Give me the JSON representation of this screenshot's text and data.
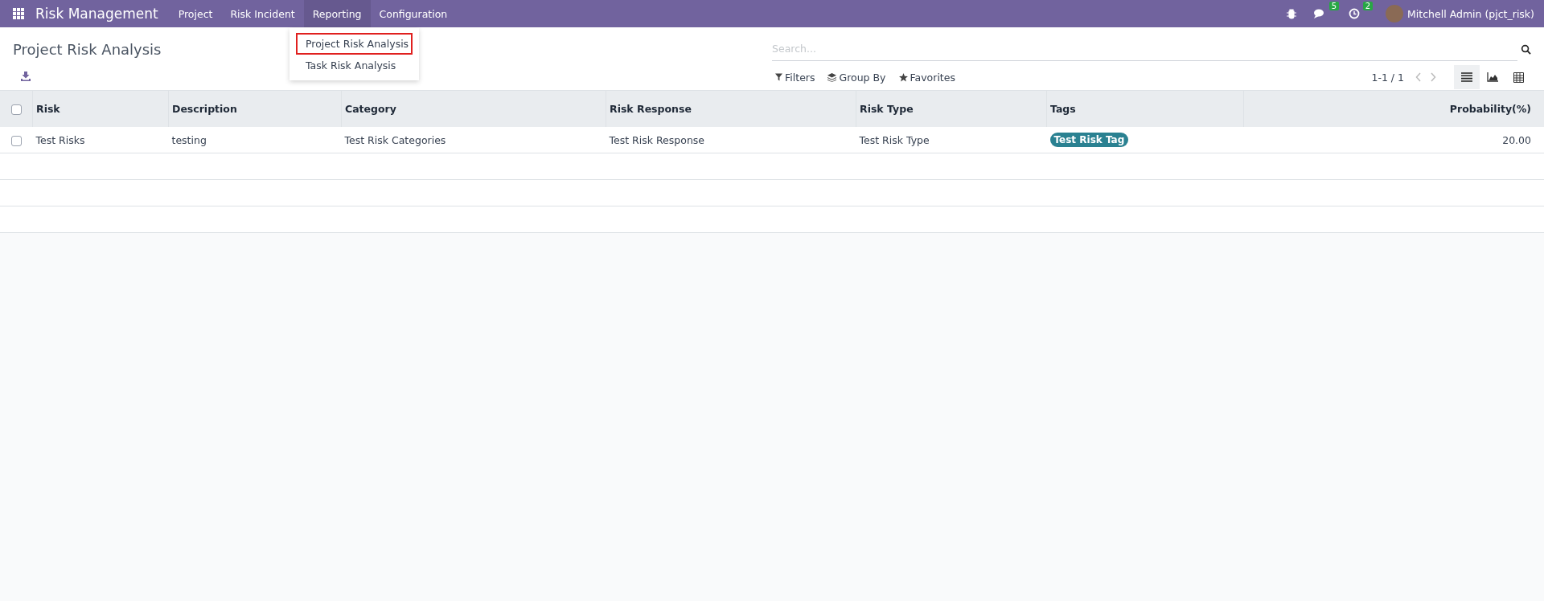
{
  "navbar": {
    "app_name": "Risk Management",
    "menu": [
      {
        "label": "Project",
        "selected": false
      },
      {
        "label": "Risk Incident",
        "selected": false
      },
      {
        "label": "Reporting",
        "selected": true
      },
      {
        "label": "Configuration",
        "selected": false
      }
    ],
    "messages_count": "5",
    "activities_count": "2",
    "user": "Mitchell Admin (pjct_risk)"
  },
  "dropdown": {
    "items": [
      {
        "label": "Project Risk Analysis",
        "selected": true
      },
      {
        "label": "Task Risk Analysis",
        "selected": false
      }
    ]
  },
  "page_title": "Project Risk Analysis",
  "search": {
    "placeholder": "Search..."
  },
  "filters": [
    "Filters",
    "Group By",
    "Favorites"
  ],
  "pager": "1-1 / 1",
  "views": [
    {
      "kind": "list",
      "selected": true
    },
    {
      "kind": "graph",
      "selected": false
    },
    {
      "kind": "pivot",
      "selected": false
    }
  ],
  "table": {
    "select_all_checked": false,
    "columns": [
      "Risk",
      "Description",
      "Category",
      "Risk Response",
      "Risk Type",
      "Tags",
      "Probability(%)"
    ],
    "rows": [
      {
        "checked": false,
        "risk": "Test Risks",
        "description": "testing",
        "category": "Test Risk Categories",
        "risk_response": "Test Risk Response",
        "risk_type": "Test Risk Type",
        "tags": [
          "Test Risk Tag"
        ],
        "probability": "20.00"
      }
    ]
  }
}
